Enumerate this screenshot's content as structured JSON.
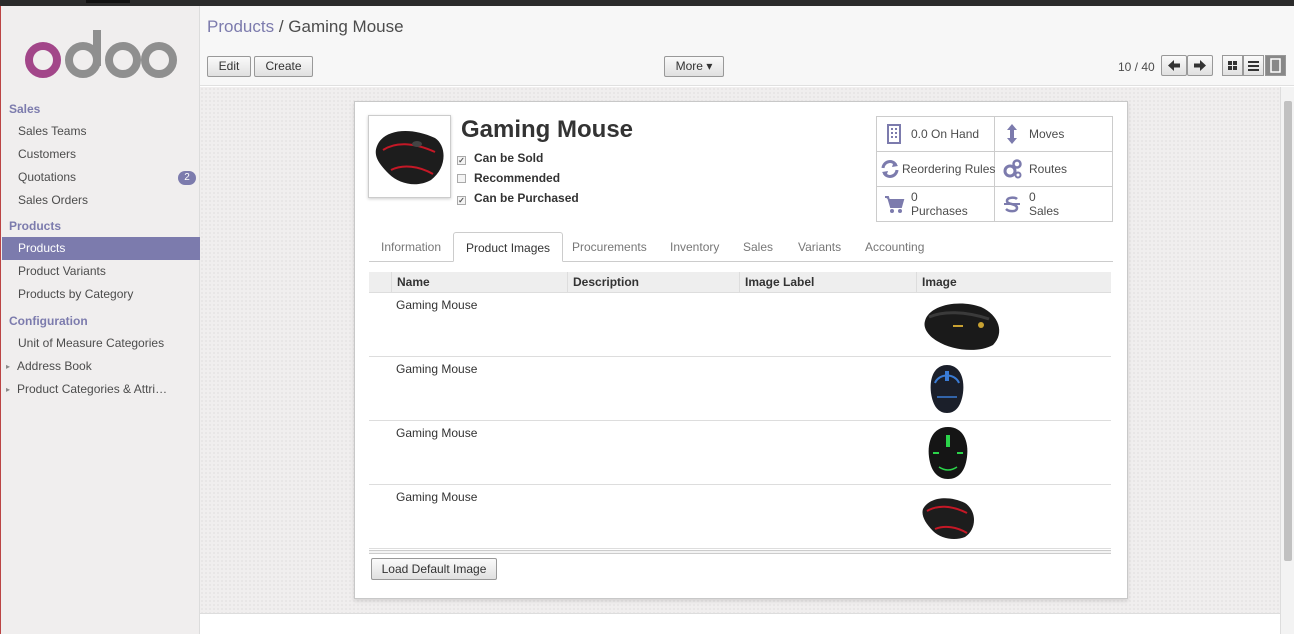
{
  "app": {
    "logo_text": "odoo"
  },
  "sidebar": {
    "sections": [
      {
        "title": "Sales",
        "items": [
          {
            "label": "Sales Teams"
          },
          {
            "label": "Customers"
          },
          {
            "label": "Quotations",
            "badge": "2"
          },
          {
            "label": "Sales Orders"
          }
        ]
      },
      {
        "title": "Products",
        "items": [
          {
            "label": "Products",
            "active": true
          },
          {
            "label": "Product Variants"
          },
          {
            "label": "Products by Category"
          }
        ]
      },
      {
        "title": "Configuration",
        "items": [
          {
            "label": "Unit of Measure Categories"
          },
          {
            "label": "Address Book",
            "collapsible": true
          },
          {
            "label": "Product Categories & Attri…",
            "collapsible": true
          }
        ]
      }
    ]
  },
  "header": {
    "breadcrumb": {
      "parent": "Products",
      "separator": "/",
      "current": "Gaming Mouse"
    },
    "buttons": {
      "edit": "Edit",
      "create": "Create",
      "more": "More ▾"
    },
    "pager": "10 / 40"
  },
  "product": {
    "name": "Gaming Mouse",
    "checkboxes": [
      {
        "label": "Can be Sold",
        "checked": true
      },
      {
        "label": "Recommended",
        "checked": false
      },
      {
        "label": "Can be Purchased",
        "checked": true
      }
    ],
    "smart_buttons": [
      {
        "icon": "building-icon",
        "value": "0.0",
        "label": "On Hand"
      },
      {
        "icon": "arrows-v-icon",
        "label": "Moves"
      },
      {
        "icon": "refresh-icon",
        "label": "Reordering Rules"
      },
      {
        "icon": "cogs-icon",
        "label": "Routes"
      },
      {
        "icon": "cart-icon",
        "value": "0",
        "label": "Purchases"
      },
      {
        "icon": "dollar-icon",
        "value": "0",
        "label": "Sales"
      }
    ]
  },
  "tabs": [
    "Information",
    "Product Images",
    "Procurements",
    "Inventory",
    "Sales",
    "Variants",
    "Accounting"
  ],
  "active_tab": "Product Images",
  "images_table": {
    "columns": [
      "Name",
      "Description",
      "Image Label",
      "Image"
    ],
    "rows": [
      {
        "name": "Gaming Mouse",
        "description": "",
        "image_label": "",
        "image": "mouse-black-yellow"
      },
      {
        "name": "Gaming Mouse",
        "description": "",
        "image_label": "",
        "image": "mouse-blue"
      },
      {
        "name": "Gaming Mouse",
        "description": "",
        "image_label": "",
        "image": "mouse-green"
      },
      {
        "name": "Gaming Mouse",
        "description": "",
        "image_label": "",
        "image": "mouse-red"
      }
    ]
  },
  "load_default_image": "Load Default Image",
  "colors": {
    "accent": "#7c7bad",
    "brand_purple": "#a24689",
    "brand_gray": "#8f8f8f"
  }
}
